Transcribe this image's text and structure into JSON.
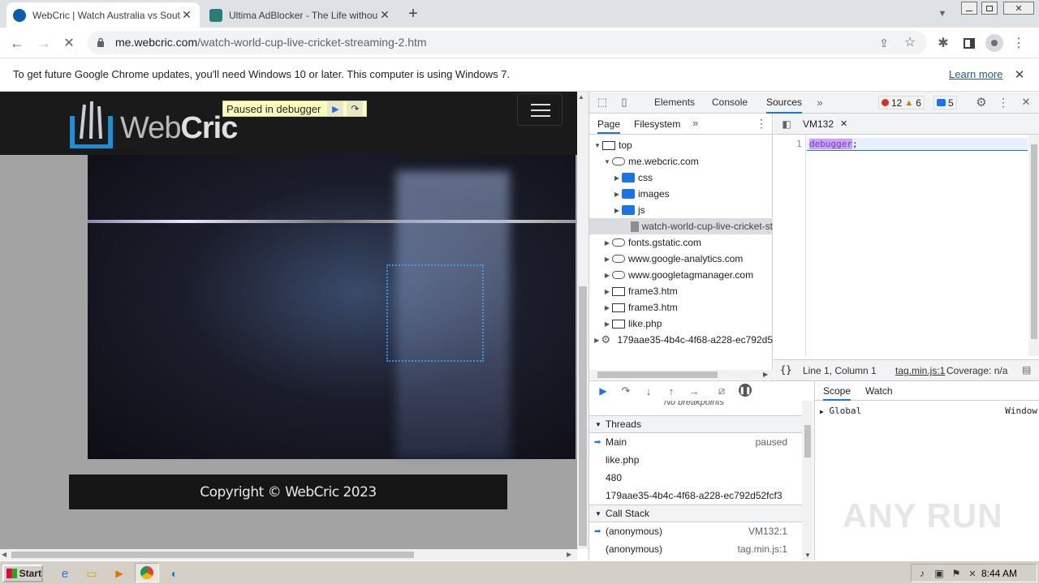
{
  "browser": {
    "tabs": [
      {
        "title": "WebCric | Watch Australia vs South"
      },
      {
        "title": "Ultima AdBlocker - The Life without A"
      }
    ],
    "new_tab": "+",
    "url_host": "me.webcric.com",
    "url_path": "/watch-world-cup-live-cricket-streaming-2.htm",
    "infobar_text": "To get future Google Chrome updates, you'll need Windows 10 or later. This computer is using Windows 7.",
    "learn_more": "Learn more"
  },
  "site": {
    "logo_text_web": "Web",
    "logo_text_cric": "Cric",
    "paused_label": "Paused in debugger",
    "copyright": "Copyright © WebCric 2023"
  },
  "devtools": {
    "tabs": [
      "Elements",
      "Console",
      "Sources"
    ],
    "errors": "12",
    "warnings": "6",
    "messages": "5",
    "nav_tabs": [
      "Page",
      "Filesystem"
    ],
    "tree": [
      {
        "label": "top"
      },
      {
        "label": "me.webcric.com"
      },
      {
        "label": "css"
      },
      {
        "label": "images"
      },
      {
        "label": "js"
      },
      {
        "label": "watch-world-cup-live-cricket-st"
      },
      {
        "label": "fonts.gstatic.com"
      },
      {
        "label": "www.google-analytics.com"
      },
      {
        "label": "www.googletagmanager.com"
      },
      {
        "label": "frame3.htm"
      },
      {
        "label": "frame3.htm"
      },
      {
        "label": "like.php"
      },
      {
        "label": "179aae35-4b4c-4f68-a228-ec792d5"
      }
    ],
    "file_tab": "VM132",
    "line_no": "1",
    "code_keyword": "debugger",
    "code_rest": ";",
    "status_pos": "Line 1, Column 1",
    "status_file": "tag.min.js:1",
    "status_coverage": "Coverage: n/a",
    "no_breakpoints": "No breakpoints",
    "threads_label": "Threads",
    "threads": [
      {
        "name": "Main",
        "state": "paused"
      },
      {
        "name": "like.php",
        "state": ""
      },
      {
        "name": "480",
        "state": ""
      },
      {
        "name": "179aae35-4b4c-4f68-a228-ec792d52fcf3",
        "state": ""
      }
    ],
    "callstack_label": "Call Stack",
    "callstack": [
      {
        "fn": "(anonymous)",
        "loc": "VM132:1"
      },
      {
        "fn": "(anonymous)",
        "loc": "tag.min.js:1"
      }
    ],
    "scope_tabs": [
      "Scope",
      "Watch"
    ],
    "scope_global": "Global",
    "scope_window": "Window",
    "watermark": "ANY RUN"
  },
  "taskbar": {
    "start": "Start",
    "time": "8:44 AM"
  }
}
